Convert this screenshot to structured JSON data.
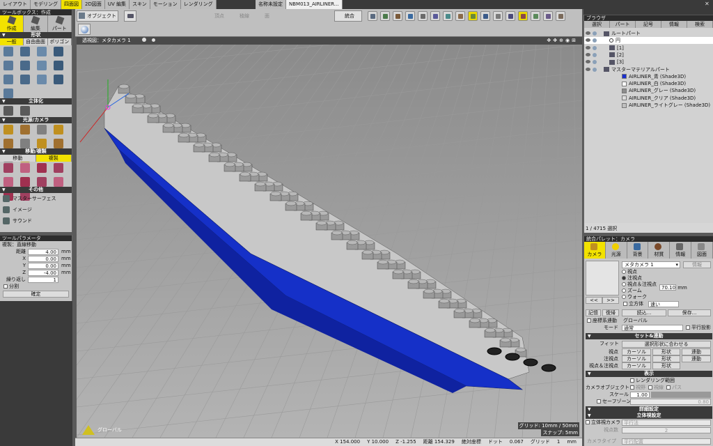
{
  "top_tabs": [
    "レイアウト",
    "モデリング",
    "四面図",
    "2D図面",
    "UV 編集",
    "スキン",
    "モーション",
    "レンダリング"
  ],
  "doc_tabs": [
    "名称未設定",
    "NBM013_AIRLINER..."
  ],
  "toolbar": {
    "object_label": "オブジェクト",
    "vertex": "頂点",
    "edge": "稜線",
    "face": "面",
    "unify": "統合"
  },
  "toolbox": {
    "title": "ツールボックス：作成",
    "tabs": [
      "作成",
      "編集",
      "パート"
    ],
    "shape_title": "形状",
    "shape_tabs": [
      "一般",
      "自由曲面",
      "ポリゴン"
    ],
    "solid_title": "立体化",
    "light_title": "光源/カメラ",
    "move_title": "移動/複製",
    "move_tabs": [
      "移動",
      "複製"
    ],
    "other_title": "その他",
    "other_items": [
      "マスターサーフェス",
      "イメージ",
      "サウンド"
    ]
  },
  "toolparam": {
    "title": "ツールパラメータ",
    "mode": "複製：直線移動",
    "distance_label": "距離",
    "distance": "4.00",
    "x": "0.00",
    "y": "0.00",
    "z": "-4.00",
    "repeat_label": "繰り返し",
    "repeat": "1",
    "split": "分割",
    "confirm": "確定",
    "unit": "mm"
  },
  "viewport": {
    "title": "透視図：メタカメラ 1",
    "grid": "グリッド: 10mm / 50mm",
    "snap": "スナップ: 5mm",
    "global": "グローバル"
  },
  "status": {
    "x": "X  154.000",
    "y": "Y  10.000",
    "z": "Z  -1.255",
    "dist": "距離  154.329",
    "abs": "絶対座標",
    "dot": "ドット",
    "dot_val": "0.067",
    "grid": "グリッド",
    "grid_val": "1",
    "unit": "mm"
  },
  "browser": {
    "title": "ブラウザ",
    "tabs": [
      "選択",
      "パート",
      "記号",
      "情報",
      "検索"
    ],
    "count": "1 / 4715 選択",
    "items": [
      "ルートパート",
      "円",
      "[1]",
      "[2]",
      "[3]",
      "マスターマテリアルパート",
      "AIRLINER_青 (Shade3D)",
      "AIRLINER_白 (Shade3D)",
      "AIRLINER_グレー (Shade3D)",
      "AIRLINER_クリア (Shade3D)",
      "AIRLINER_ライトグレー (Shade3D)"
    ],
    "mat_colors": [
      "#1a2fd0",
      "#ffffff",
      "#8c8c8c",
      "#dcdcdc",
      "#c0c0c0"
    ]
  },
  "palette": {
    "title": "統合パレット：カメラ",
    "tabs": [
      "カメラ",
      "光源",
      "背景",
      "材質",
      "情報",
      "図面"
    ],
    "camera_select": "メタカメラ 1",
    "info_btn": "情報",
    "opts": [
      "視点",
      "注視点",
      "視点＆注視点",
      "ズーム",
      "ウォーク"
    ],
    "zoom_val": "70.10",
    "zoom_unit": "mm",
    "cube": "立方体",
    "speed": "速い",
    "nav": [
      "<<",
      ">>"
    ],
    "memo": "記憶",
    "restore": "復帰",
    "load": "読込...",
    "save": "保存...",
    "coord_link": "座標系連動",
    "coord_val": "グローバル",
    "mode_label": "モード",
    "mode_val": "通常",
    "parallel": "平行投影",
    "set_title": "セット&連動",
    "fit": "フィット",
    "fit_val": "選択形状に合わせる",
    "grid_rows": [
      [
        "視点",
        "カーソル",
        "形状",
        "連動"
      ],
      [
        "注視点",
        "カーソル",
        "形状",
        "連動"
      ],
      [
        "視点＆注視点",
        "カーソル",
        "形状",
        ""
      ]
    ],
    "disp_title": "表示",
    "render_range": "レンダリング範囲",
    "cam_obj": "カメラオブジェクト",
    "cam_obj_opts": [
      "視野",
      "視線",
      "パス"
    ],
    "scale_label": "スケール",
    "scale_val": "1.00",
    "safe_zone": "セーフゾーン",
    "safe_val": "0.80",
    "detail_title": "詳細設定",
    "stereo_title": "立体視設定",
    "stereo_cam": "立体視カメラ",
    "stereo_val": "平行法",
    "view_count_label": "視点数",
    "view_count": "2",
    "cam_type_label": "カメラタイプ",
    "cam_type": "平行配置"
  }
}
